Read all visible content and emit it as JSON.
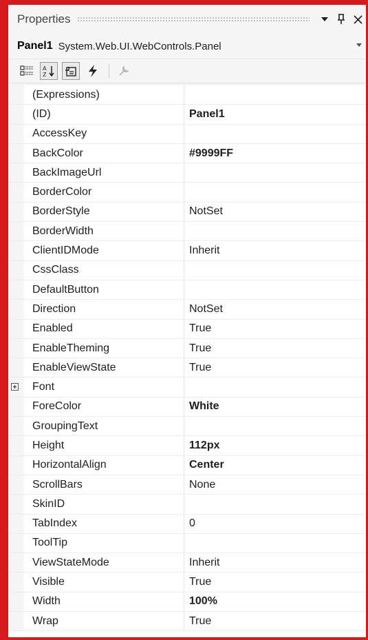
{
  "panel": {
    "title": "Properties",
    "dropdown_icon": "▾",
    "pin_icon": "ꟼ",
    "close_icon": "✕"
  },
  "object": {
    "name": "Panel1",
    "type": "System.Web.UI.WebControls.Panel"
  },
  "toolbar": {
    "buttons": [
      {
        "name": "categorized-icon",
        "selected": false
      },
      {
        "name": "alphabetical-icon",
        "selected": true
      },
      {
        "name": "properties-icon",
        "selected": true
      },
      {
        "name": "events-icon",
        "selected": false
      },
      {
        "name": "property-pages-icon",
        "selected": false
      }
    ]
  },
  "properties": [
    {
      "name": "(Expressions)",
      "value": "",
      "bold": false
    },
    {
      "name": "(ID)",
      "value": "Panel1",
      "bold": true
    },
    {
      "name": "AccessKey",
      "value": "",
      "bold": false
    },
    {
      "name": "BackColor",
      "value": "#9999FF",
      "bold": true
    },
    {
      "name": "BackImageUrl",
      "value": "",
      "bold": false
    },
    {
      "name": "BorderColor",
      "value": "",
      "bold": false
    },
    {
      "name": "BorderStyle",
      "value": "NotSet",
      "bold": false
    },
    {
      "name": "BorderWidth",
      "value": "",
      "bold": false
    },
    {
      "name": "ClientIDMode",
      "value": "Inherit",
      "bold": false
    },
    {
      "name": "CssClass",
      "value": "",
      "bold": false
    },
    {
      "name": "DefaultButton",
      "value": "",
      "bold": false
    },
    {
      "name": "Direction",
      "value": "NotSet",
      "bold": false
    },
    {
      "name": "Enabled",
      "value": "True",
      "bold": false
    },
    {
      "name": "EnableTheming",
      "value": "True",
      "bold": false
    },
    {
      "name": "EnableViewState",
      "value": "True",
      "bold": false
    },
    {
      "name": "Font",
      "value": "",
      "bold": false,
      "expandable": true
    },
    {
      "name": "ForeColor",
      "value": "White",
      "bold": true
    },
    {
      "name": "GroupingText",
      "value": "",
      "bold": false
    },
    {
      "name": "Height",
      "value": "112px",
      "bold": true
    },
    {
      "name": "HorizontalAlign",
      "value": "Center",
      "bold": true
    },
    {
      "name": "ScrollBars",
      "value": "None",
      "bold": false
    },
    {
      "name": "SkinID",
      "value": "",
      "bold": false
    },
    {
      "name": "TabIndex",
      "value": "0",
      "bold": false
    },
    {
      "name": "ToolTip",
      "value": "",
      "bold": false
    },
    {
      "name": "ViewStateMode",
      "value": "Inherit",
      "bold": false
    },
    {
      "name": "Visible",
      "value": "True",
      "bold": false
    },
    {
      "name": "Width",
      "value": "100%",
      "bold": true
    },
    {
      "name": "Wrap",
      "value": "True",
      "bold": false
    }
  ],
  "colors": {
    "frame": "#d41a1a",
    "background": "#f5f5f5",
    "grid_background": "#ffffff"
  }
}
